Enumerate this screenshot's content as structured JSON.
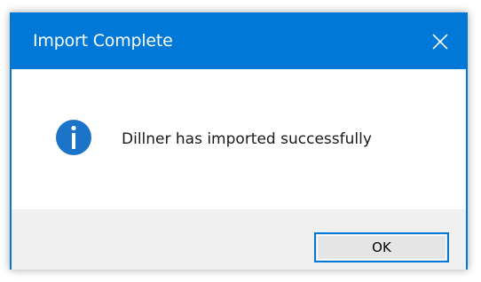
{
  "dialog": {
    "title": "Import Complete",
    "message": "Dillner has imported successfully",
    "ok_label": "OK",
    "icon": "info-icon",
    "close_icon": "close-icon"
  },
  "colors": {
    "titlebar": "#0078d7",
    "icon_fill": "#1c74c9",
    "footer": "#f0f0f0",
    "button_border": "#0078d7"
  }
}
